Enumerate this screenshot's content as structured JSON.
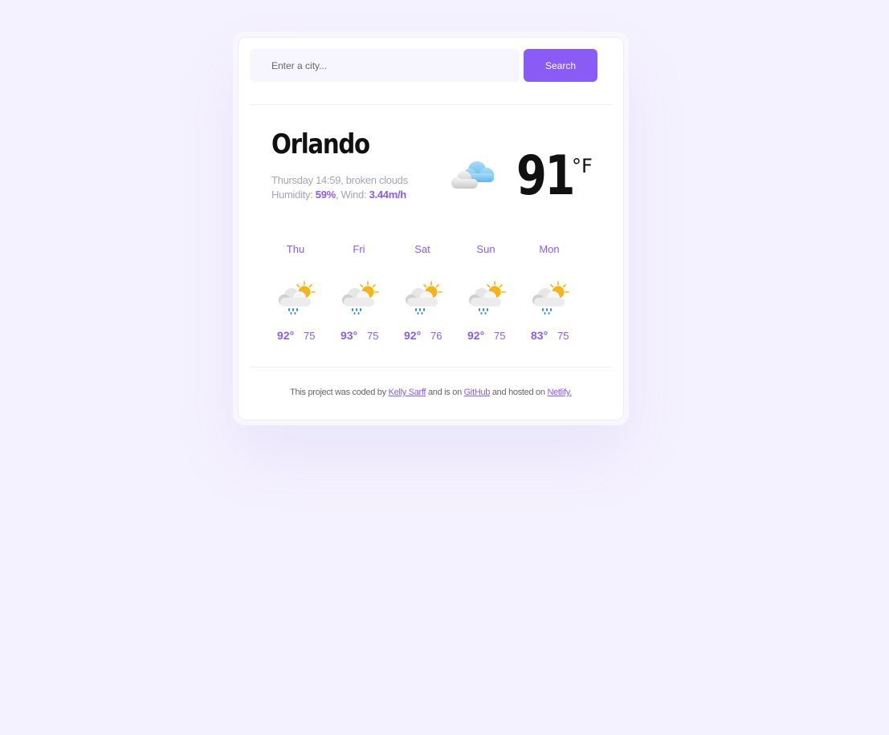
{
  "search": {
    "placeholder": "Enter a city...",
    "value": "",
    "button_label": "Search"
  },
  "current": {
    "city": "Orlando",
    "day_time_desc": "Thursday 14:59, broken clouds",
    "humidity_label": "Humidity:",
    "humidity_value": "59%",
    "wind_label": ", Wind:",
    "wind_value": "3.44m/h",
    "temperature": "91",
    "unit": "°F",
    "icon": "cloud-icon"
  },
  "forecast": [
    {
      "day": "Thu",
      "high": "92°",
      "low": "75",
      "icon": "rain-sun-cloud-icon"
    },
    {
      "day": "Fri",
      "high": "93°",
      "low": "75",
      "icon": "rain-sun-cloud-icon"
    },
    {
      "day": "Sat",
      "high": "92°",
      "low": "76",
      "icon": "rain-sun-cloud-icon"
    },
    {
      "day": "Sun",
      "high": "92°",
      "low": "75",
      "icon": "rain-sun-cloud-icon"
    },
    {
      "day": "Mon",
      "high": "83°",
      "low": "75",
      "icon": "rain-sun-cloud-icon"
    }
  ],
  "footer": {
    "text_1": "This project was coded by ",
    "link_author": "Kelly Sarff",
    "text_2": " and is on ",
    "link_github": "GitHub",
    "text_3": " and hosted on ",
    "link_netlify": "Netlify."
  },
  "colors": {
    "accent": "#8a5cf5",
    "background": "#f5f2ff"
  }
}
